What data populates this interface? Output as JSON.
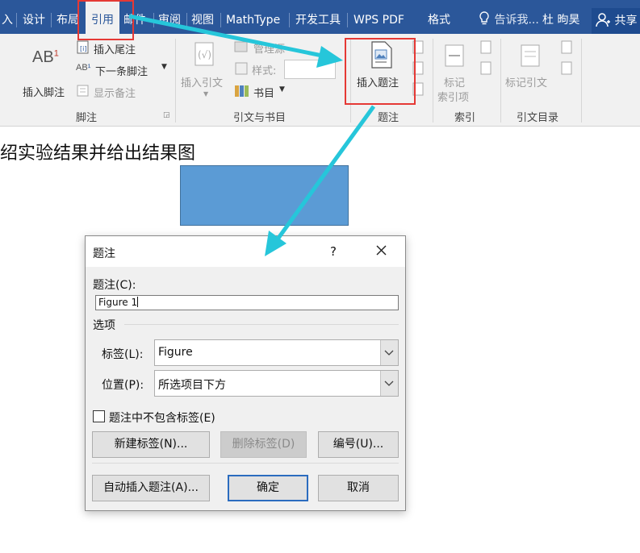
{
  "tabs": [
    {
      "label": "入"
    },
    {
      "label": "设计"
    },
    {
      "label": "布局"
    },
    {
      "label": "引用"
    },
    {
      "label": "邮件"
    },
    {
      "label": "审阅"
    },
    {
      "label": "视图"
    },
    {
      "label": "MathType"
    },
    {
      "label": "开发工具"
    },
    {
      "label": "WPS PDF"
    },
    {
      "label": "格式"
    }
  ],
  "active_tab": "引用",
  "tell_me": "告诉我...",
  "user_name": "杜 昫昊",
  "share_label": "共享",
  "ribbon": {
    "footnote": {
      "insert_footnote": "插入脚注",
      "insert_endnote": "插入尾注",
      "next_footnote": "下一条脚注",
      "show_notes": "显示备注",
      "group_label": "脚注"
    },
    "citations": {
      "insert_citation": "插入引文",
      "manage_sources": "管理源",
      "style_label": "样式:",
      "bibliography": "书目",
      "group_label": "引文与书目"
    },
    "captions": {
      "insert_caption": "插入题注",
      "group_label": "题注"
    },
    "index": {
      "mark_entry_line1": "标记",
      "mark_entry_line2": "索引项",
      "group_label": "索引"
    },
    "toa": {
      "mark_citation": "标记引文",
      "group_label": "引文目录"
    }
  },
  "document": {
    "heading_text": "绍实验结果并给出结果图"
  },
  "dialog": {
    "title": "题注",
    "help": "?",
    "caption_label": "题注(C):",
    "caption_value": "Figure 1",
    "options_label": "选项",
    "label_field_label": "标签(L):",
    "label_value": "Figure",
    "position_label": "位置(P):",
    "position_value": "所选项目下方",
    "exclude_label_text": "题注中不包含标签(E)",
    "exclude_label_checked": false,
    "new_label_button": "新建标签(N)...",
    "delete_label_button": "删除标签(D)",
    "numbering_button": "编号(U)...",
    "autocaption_button": "自动插入题注(A)...",
    "ok_button": "确定",
    "cancel_button": "取消"
  },
  "colors": {
    "tab_bar": "#2b579a",
    "highlight_box": "#e53935",
    "arrow": "#26c6da",
    "shape_fill": "#5b9bd5"
  }
}
